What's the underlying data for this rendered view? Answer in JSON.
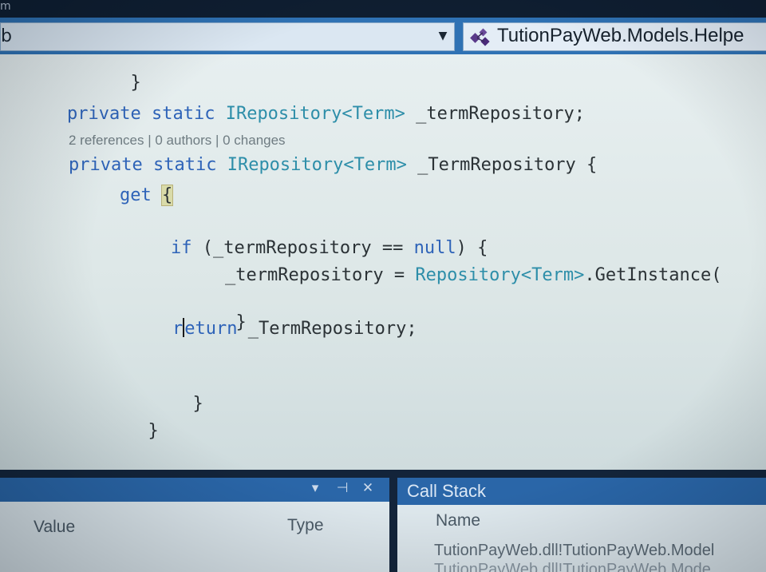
{
  "window": {
    "top_fragment": "m"
  },
  "navigation_bar": {
    "left_dropdown_value": "b",
    "right_dropdown_value": "TutionPayWeb.Models.Helpe"
  },
  "editor": {
    "lines": {
      "closing_brace_top": "}",
      "field_kw_private": "private",
      "field_kw_static": "static",
      "field_type": "IRepository<Term>",
      "field_name": "_termRepository;",
      "codelens": "2 references | 0 authors | 0 changes",
      "prop_kw_private": "private",
      "prop_kw_static": "static",
      "prop_type": "IRepository<Term>",
      "prop_name": "_TermRepository {",
      "get_kw": "get",
      "get_brace": "{",
      "if_kw": "if",
      "if_cond_start": "(_termRepository ==",
      "null_kw": "null",
      "if_cond_end": ") {",
      "assign_lhs": "_termRepository =",
      "assign_type": "Repository<Term>",
      "assign_call": ".GetInstance(",
      "if_close": "}",
      "return_r": "r",
      "return_rest": "eturn",
      "return_value": "_TermRepository;",
      "get_close": "}",
      "prop_close": "}"
    }
  },
  "locals_panel": {
    "dropdown_glyph": "▾",
    "pin_glyph": "⊣",
    "close_glyph": "✕",
    "columns": [
      "Value",
      "Type"
    ]
  },
  "call_stack_panel": {
    "title": "Call Stack",
    "column": "Name",
    "rows": [
      "TutionPayWeb.dll!TutionPayWeb.Model",
      "TutionPayWeb.dll!TutionPayWeb.Mode"
    ]
  }
}
